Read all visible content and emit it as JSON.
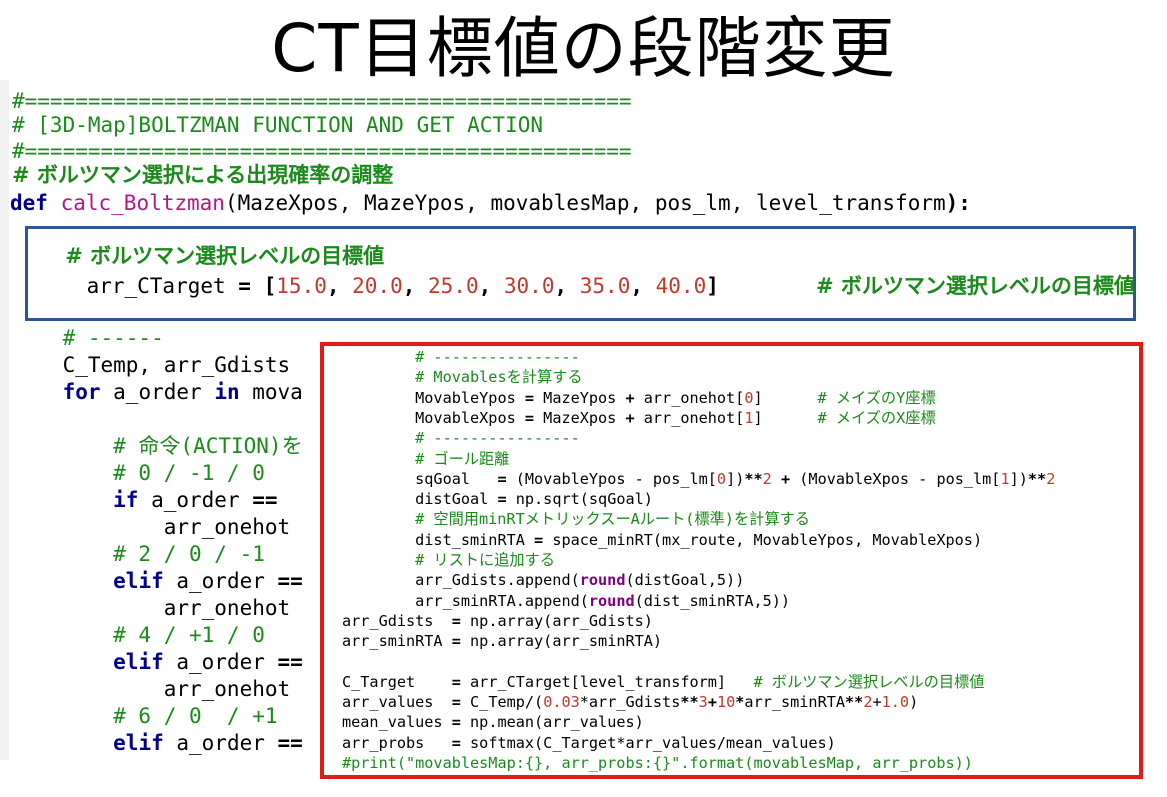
{
  "title": "CT目標値の段階変更",
  "background_code": [
    {
      "text": "#================================================",
      "cls": "c"
    },
    {
      "text": "# [3D-Map]BOLTZMAN FUNCTION AND GET ACTION",
      "cls": "c"
    },
    {
      "text": "#================================================",
      "cls": "c"
    },
    {
      "text": "# ボルツマン選択による出現確率の調整",
      "cls": "c jp"
    },
    {
      "text": "def calc_Boltzman(MazeXpos, MazeYpos, movablesMap, pos_lm, level_transform):",
      "cls": "def"
    },
    {
      "text": "    # ------",
      "cls": "c"
    },
    {
      "text": "    C_Temp, arr_Gdists",
      "cls": ""
    },
    {
      "text": "    for a_order in mova",
      "cls": "for"
    },
    {
      "text": "        # 命令(ACTION)を",
      "cls": "c"
    },
    {
      "text": "        # 0 / -1 / 0",
      "cls": "c"
    },
    {
      "text": "        if a_order ==",
      "cls": "if"
    },
    {
      "text": "            arr_onehot",
      "cls": ""
    },
    {
      "text": "        # 2 / 0 / -1",
      "cls": "c"
    },
    {
      "text": "        elif a_order ==",
      "cls": "elif"
    },
    {
      "text": "            arr_onehot",
      "cls": ""
    },
    {
      "text": "        # 4 / +1 / 0",
      "cls": "c"
    },
    {
      "text": "        elif a_order ==",
      "cls": "elif"
    },
    {
      "text": "            arr_onehot",
      "cls": ""
    },
    {
      "text": "        # 6 / 0  / +1",
      "cls": "c"
    },
    {
      "text": "        elif a_order ==",
      "cls": "elif"
    }
  ],
  "blue_box": {
    "comment": "    # ボルツマン選択レベルの目標値",
    "code_prefix": "    arr_CTarget = [",
    "values": [
      "15.0",
      "20.0",
      "25.0",
      "30.0",
      "35.0",
      "40.0"
    ],
    "trailing_comment": "# ボルツマン選択レベルの目標値"
  },
  "red_box_lines": [
    "        # ----------------",
    "        # Movablesを計算する",
    "        MovableYpos = MazeYpos + arr_onehot[0]      # メイズのY座標",
    "        MovableXpos = MazeXpos + arr_onehot[1]      # メイズのX座標",
    "        # ----------------",
    "        # ゴール距離",
    "        sqGoal   = (MovableYpos - pos_lm[0])**2 + (MovableXpos - pos_lm[1])**2",
    "        distGoal = np.sqrt(sqGoal)",
    "        # 空間用minRTメトリックスーAルート(標準)を計算する",
    "        dist_sminRTA = space_minRT(mx_route, MovableYpos, MovableXpos)",
    "        # リストに追加する",
    "        arr_Gdists.append(round(distGoal,5))",
    "        arr_sminRTA.append(round(dist_sminRTA,5))",
    "arr_Gdists  = np.array(arr_Gdists)",
    "arr_sminRTA = np.array(arr_sminRTA)",
    "",
    "C_Target    = arr_CTarget[level_transform]   # ボルツマン選択レベルの目標値",
    "arr_values  = C_Temp/(0.03*arr_Gdists**3+10*arr_sminRTA**2+1.0)",
    "mean_values = np.mean(arr_values)",
    "arr_probs   = softmax(C_Target*arr_values/mean_values)",
    "#print(\"movablesMap:{}, arr_probs:{}\".format(movablesMap, arr_probs))"
  ],
  "colors": {
    "comment": "#1b8a1b",
    "keyword": "#00008b",
    "function": "#b0178b",
    "number": "#c0392b",
    "blue_border": "#2f5597",
    "red_border": "#e11a1a"
  }
}
